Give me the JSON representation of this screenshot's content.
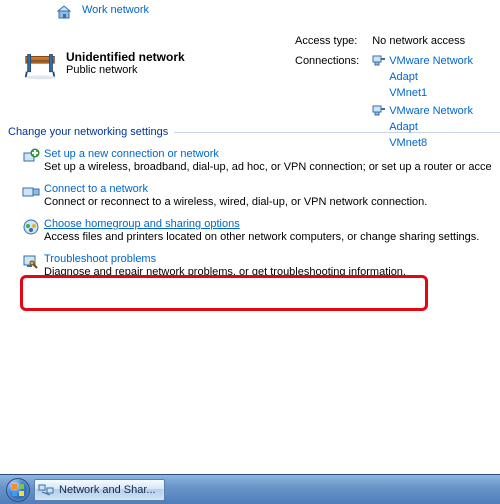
{
  "networks": {
    "workLink": "Work network",
    "unidentified": {
      "title": "Unidentified network",
      "subtitle": "Public network"
    }
  },
  "right": {
    "accessTypeLabel": "Access type:",
    "accessTypeValue": "No network access",
    "connectionsLabel": "Connections:",
    "adapters": [
      {
        "line1": "VMware Network Adapt",
        "line2": "VMnet1"
      },
      {
        "line1": "VMware Network Adapt",
        "line2": "VMnet8"
      }
    ]
  },
  "sectionTitle": "Change your networking settings",
  "settings": [
    {
      "link": "Set up a new connection or network",
      "desc": "Set up a wireless, broadband, dial-up, ad hoc, or VPN connection; or set up a router or acce"
    },
    {
      "link": "Connect to a network",
      "desc": "Connect or reconnect to a wireless, wired, dial-up, or VPN network connection."
    },
    {
      "link": "Choose homegroup and sharing options",
      "desc": "Access files and printers located on other network computers, or change sharing settings."
    },
    {
      "link": "Troubleshoot problems",
      "desc": "Diagnose and repair network problems, or get troubleshooting information."
    }
  ],
  "taskbar": {
    "taskButton": "Network and Shar..."
  }
}
